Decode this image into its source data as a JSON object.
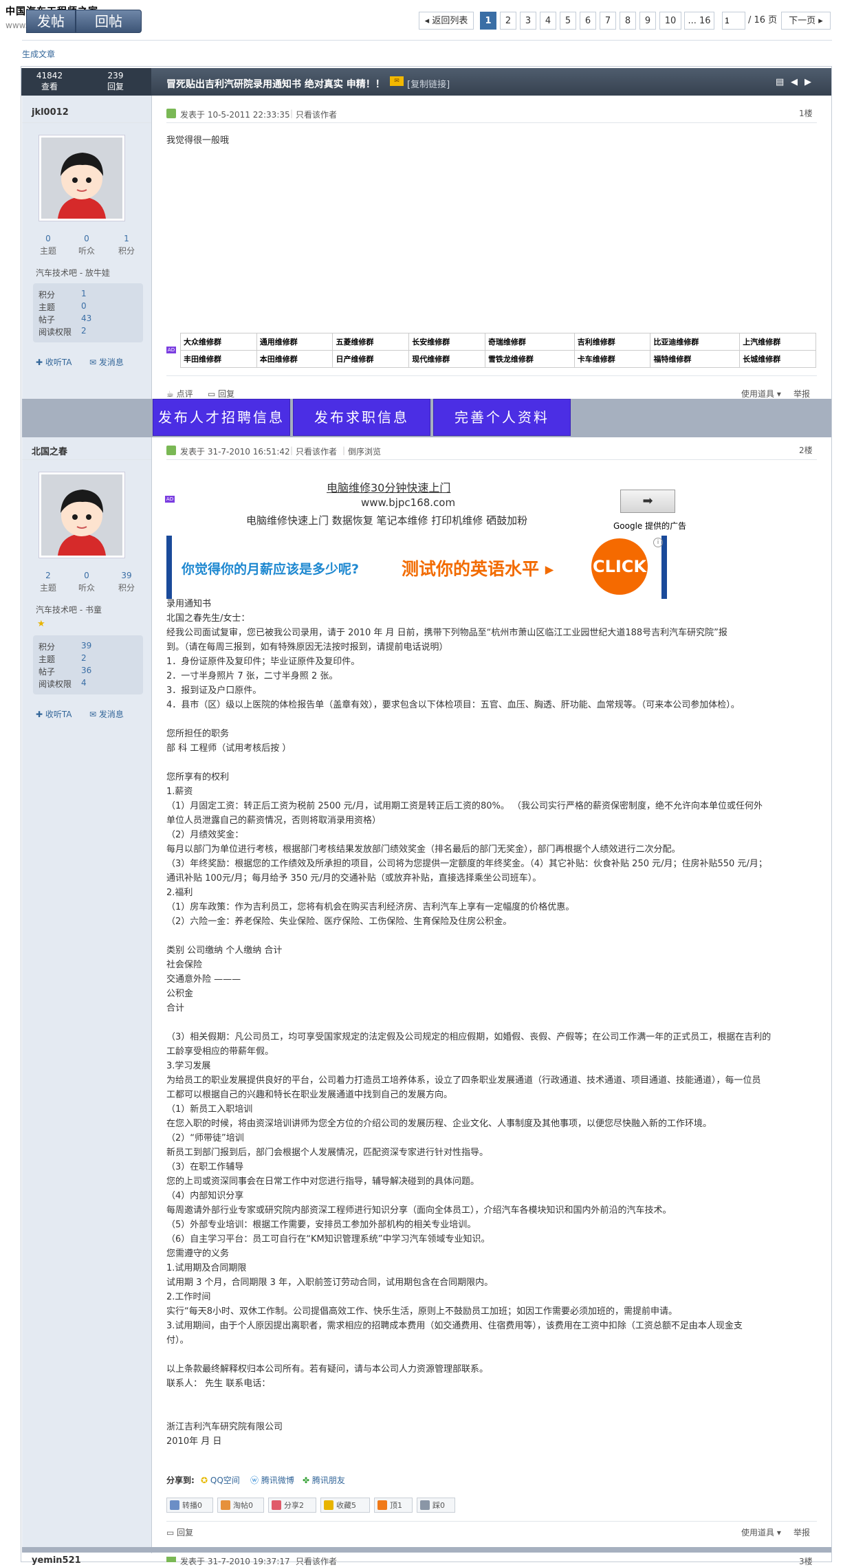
{
  "site": {
    "logo_line1": "中国汽车工程师之家",
    "logo_line2": "www.cartech8.com"
  },
  "toolbar": {
    "post_label": "发帖",
    "reply_label": "回帖"
  },
  "pagination": {
    "back_label": "返回列表",
    "pages": [
      "1",
      "2",
      "3",
      "4",
      "5",
      "6",
      "7",
      "8",
      "9",
      "10",
      "... 16"
    ],
    "current": "1",
    "jump_value": "1",
    "total_label": "/ 16 页",
    "next_label": "下一页"
  },
  "breadcrumb": {
    "gen_article": "生成文章"
  },
  "thread": {
    "views": "41842",
    "views_label": "查看",
    "replies": "239",
    "replies_label": "回复",
    "title": "冒死贴出吉利汽研院录用通知书 绝对真实 申精！！",
    "copy_link": "[复制链接]"
  },
  "post1": {
    "author": "jkl0012",
    "counts": [
      {
        "n": "0",
        "l": "主题"
      },
      {
        "n": "0",
        "l": "听众"
      },
      {
        "n": "1",
        "l": "积分"
      }
    ],
    "user_title": "汽车技术吧 - 放牛娃",
    "stats": [
      {
        "k": "积分",
        "v": "1"
      },
      {
        "k": "主题",
        "v": "0"
      },
      {
        "k": "帖子",
        "v": "43"
      },
      {
        "k": "阅读权限",
        "v": "2"
      }
    ],
    "follow": "收听TA",
    "message": "发消息",
    "meta_posted": "发表于 10-5-2011 22:33:35",
    "meta_author_only": "只看该作者",
    "floor": "1楼",
    "content": "我觉得很一般哦",
    "repair_links": [
      [
        "大众维修群",
        "通用维修群",
        "五菱维修群",
        "长安维修群",
        "奇瑞维修群",
        "吉利维修群",
        "比亚迪维修群",
        "上汽维修群"
      ],
      [
        "丰田维修群",
        "本田维修群",
        "日产维修群",
        "现代维修群",
        "雪铁龙维修群",
        "卡车维修群",
        "福特维修群",
        "长城维修群"
      ]
    ],
    "rate": "点评",
    "reply": "回复",
    "tools": "使用道具",
    "report": "举报"
  },
  "promo_buttons": [
    "发布人才招聘信息",
    "发布求职信息",
    "完善个人资料"
  ],
  "post2": {
    "author": "北国之春",
    "counts": [
      {
        "n": "2",
        "l": "主题"
      },
      {
        "n": "0",
        "l": "听众"
      },
      {
        "n": "39",
        "l": "积分"
      }
    ],
    "user_title": "汽车技术吧 - 书童",
    "stats": [
      {
        "k": "积分",
        "v": "39"
      },
      {
        "k": "主题",
        "v": "2"
      },
      {
        "k": "帖子",
        "v": "36"
      },
      {
        "k": "阅读权限",
        "v": "4"
      }
    ],
    "follow": "收听TA",
    "message": "发消息",
    "meta_posted": "发表于 31-7-2010 16:51:42",
    "meta_author_only": "只看该作者",
    "meta_reverse": "倒序浏览",
    "floor": "2楼",
    "ad": {
      "title": "电脑维修30分钟快速上门",
      "url": "www.bjpc168.com",
      "desc": "电脑维修快速上门  数据恢复  笔记本维修  打印机维修  硒鼓加粉",
      "google": "Google 提供的广告",
      "banner_question": "你觉得你的月薪应该是多少呢?",
      "banner_test": "测试你的英语水平 ▸",
      "banner_click": "CLICK"
    },
    "lines": [
      "录用通知书",
      "北国之春先生/女士：",
      "     经我公司面试复审，您已被我公司录用，请于 2010  年   月   日前，携带下列物品至“杭州市萧山区临江工业园世纪大道188号吉利汽车研究院”报",
      "到。（请在每周三报到，如有特殊原因无法按时报到，请提前电话说明）",
      "    1．身份证原件及复印件；毕业证原件及复印件。",
      "    2．一寸半身照片 7 张，二寸半身照 2 张。",
      "    3．报到证及户口原件。",
      "4．县市（区）级以上医院的体检报告单（盖章有效），要求包含以下体检项目：五官、血压、胸透、肝功能、血常规等。（可来本公司参加体检）。",
      "",
      "                    您所担任的职务",
      "     部             科                工程师（试用考核后按         ）",
      "",
      "                    您所享有的权利",
      "1.薪资",
      "（1）月固定工资：转正后工资为税前  2500  元/月，试用期工资是转正后工资的80%。  （我公司实行严格的薪资保密制度，绝不允许向本单位或任何外",
      "单位人员泄露自己的薪资情况，否则将取消录用资格）",
      "（2）月绩效奖金：",
      "每月以部门为单位进行考核，根据部门考核结果发放部门绩效奖金（排名最后的部门无奖金），部门再根据个人绩效进行二次分配。",
      "（3）年终奖励：根据您的工作绩效及所承担的项目，公司将为您提供一定额度的年终奖金。（4）其它补贴：伙食补贴 250 元/月；住房补贴550 元/月；",
      "通讯补贴 100元/月；每月给予 350 元/月的交通补贴（或放弃补贴，直接选择乘坐公司班车）。",
      "2.福利",
      "（1）房车政策：作为吉利员工，您将有机会在购买吉利经济房、吉利汽车上享有一定幅度的价格优惠。",
      "（2）六险一金：养老保险、失业保险、医疗保险、工伤保险、生育保险及住房公积金。",
      "",
      "类别          公司缴纳          个人缴纳          合计",
      "社会保险",
      "交通意外险                  ———",
      "公积金",
      "合计",
      "",
      "（3）相关假期：凡公司员工，均可享受国家规定的法定假及公司规定的相应假期，如婚假、丧假、产假等；在公司工作满一年的正式员工，根据在吉利的",
      "工龄享受相应的带薪年假。",
      "3.学习发展",
      "为给员工的职业发展提供良好的平台，公司着力打造员工培养体系，设立了四条职业发展通道（行政通道、技术通道、项目通道、技能通道），每一位员",
      "工都可以根据自己的兴趣和特长在职业发展通道中找到自己的发展方向。",
      "（1）新员工入职培训",
      "在您入职的时候，将由资深培训讲师为您全方位的介绍公司的发展历程、企业文化、人事制度及其他事项，以便您尽快融入新的工作环境。",
      "（2）“师带徒”培训",
      "新员工到部门报到后，部门会根据个人发展情况，匹配资深专家进行针对性指导。",
      "（3）在职工作辅导",
      "您的上司或资深同事会在日常工作中对您进行指导，辅导解决碰到的具体问题。",
      "（4）内部知识分享",
      "每周邀请外部行业专家或研究院内部资深工程师进行知识分享（面向全体员工），介绍汽车各模块知识和国内外前沿的汽车技术。",
      "（5）外部专业培训：根据工作需要，安排员工参加外部机构的相关专业培训。",
      "（6）自主学习平台：员工可自行在“KM知识管理系统”中学习汽车领域专业知识。",
      "                    您需遵守的义务",
      "1.试用期及合同期限",
      "试用期 3 个月，合同期限 3 年，入职前签订劳动合同，试用期包含在合同期限内。",
      "2.工作时间",
      "实行“每天8小时、双休工作制。公司提倡高效工作、快乐生活，原则上不鼓励员工加班；如因工作需要必须加班的，需提前申请。",
      "3.试用期间，由于个人原因提出离职者，需求相应的招聘成本费用（如交通费用、住宿费用等），该费用在工资中扣除（工资总额不足由本人现金支",
      "付）。",
      "",
      "以上条款最终解释权归本公司所有。若有疑问，请与本公司人力资源管理部联系。",
      "联系人：  先生  联系电话：",
      "",
      "",
      "浙江吉利汽车研究院有限公司",
      "2010年 月 日"
    ],
    "share_label": "分享到:",
    "share_items": [
      "QQ空间",
      "腾讯微博",
      "腾讯朋友"
    ],
    "mini_buttons": [
      "转播0",
      "淘帖0",
      "分享2",
      "收藏5",
      "顶1",
      "踩0"
    ],
    "reply": "回复",
    "tools": "使用道具",
    "report": "举报"
  },
  "post3": {
    "author": "yemin521",
    "meta_posted": "发表于 31-7-2010 19:37:17",
    "meta_author_only": "只看该作者",
    "floor": "3楼"
  }
}
